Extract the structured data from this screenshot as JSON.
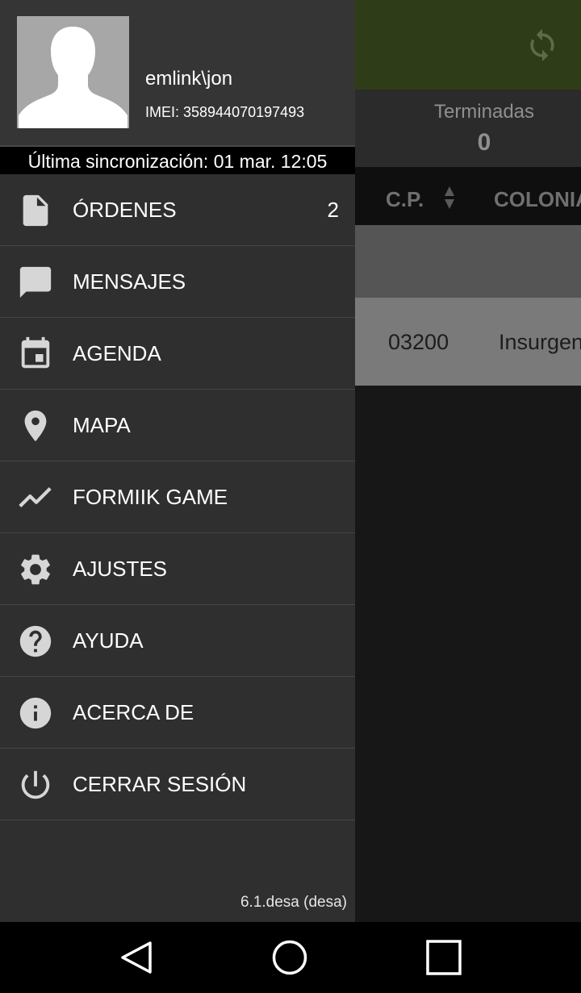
{
  "background": {
    "stats_label": "Terminadas",
    "stats_value": "0",
    "columns": [
      "C.P.",
      "COLONIA"
    ],
    "row": {
      "cp": "03200",
      "colonia": "Insurgen"
    }
  },
  "profile": {
    "username": "emlink\\jon",
    "imei": "IMEI: 358944070197493"
  },
  "sync": {
    "text": "Última sincronización: 01 mar. 12:05"
  },
  "menu": {
    "items": [
      {
        "label": "ÓRDENES",
        "badge": "2",
        "icon": "document-icon"
      },
      {
        "label": "MENSAJES",
        "icon": "message-icon"
      },
      {
        "label": "AGENDA",
        "icon": "calendar-icon"
      },
      {
        "label": "MAPA",
        "icon": "map-pin-icon"
      },
      {
        "label": "FORMIIK GAME",
        "icon": "trend-icon"
      },
      {
        "label": "AJUSTES",
        "icon": "gear-icon"
      },
      {
        "label": "AYUDA",
        "icon": "help-icon"
      },
      {
        "label": "ACERCA DE",
        "icon": "info-icon"
      },
      {
        "label": "CERRAR SESIÓN",
        "icon": "power-icon"
      }
    ]
  },
  "version": "6.1.desa (desa)",
  "colors": {
    "toolbar": "#2e3d18",
    "drawer": "#2f2f2f",
    "icon": "#d6d6d6"
  }
}
